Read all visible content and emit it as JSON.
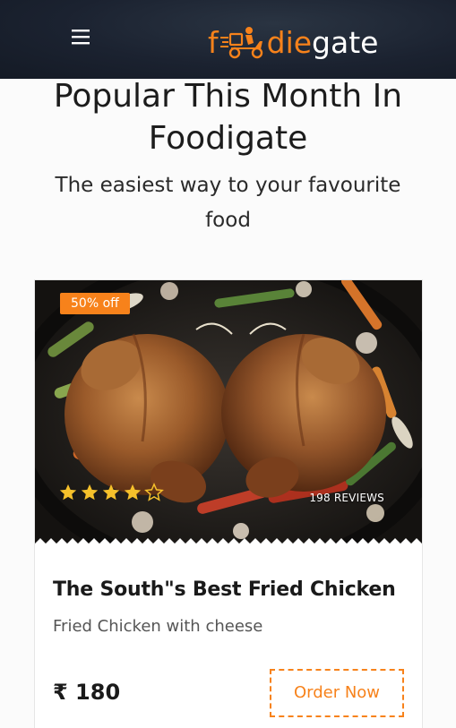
{
  "header": {
    "logo": {
      "part1": "f",
      "part2": "die",
      "part3": "gate",
      "moped_icon": "moped-icon"
    },
    "menu_icon": "hamburger-icon",
    "colors": {
      "background": "#1b2230",
      "brand_orange": "#f7821b"
    }
  },
  "hero": {
    "title": "Popular This Month In Foodigate",
    "subtitle": "The easiest way to your favourite food"
  },
  "card": {
    "discount": "50% off",
    "rating": 4,
    "rating_max": 5,
    "reviews": "198 REVIEWS",
    "title": "The South\"s Best Fried Chicken",
    "description": "Fried Chicken with cheese",
    "price": "₹ 180",
    "order_label": "Order Now",
    "image_icon": "roast-chicken-photo"
  }
}
